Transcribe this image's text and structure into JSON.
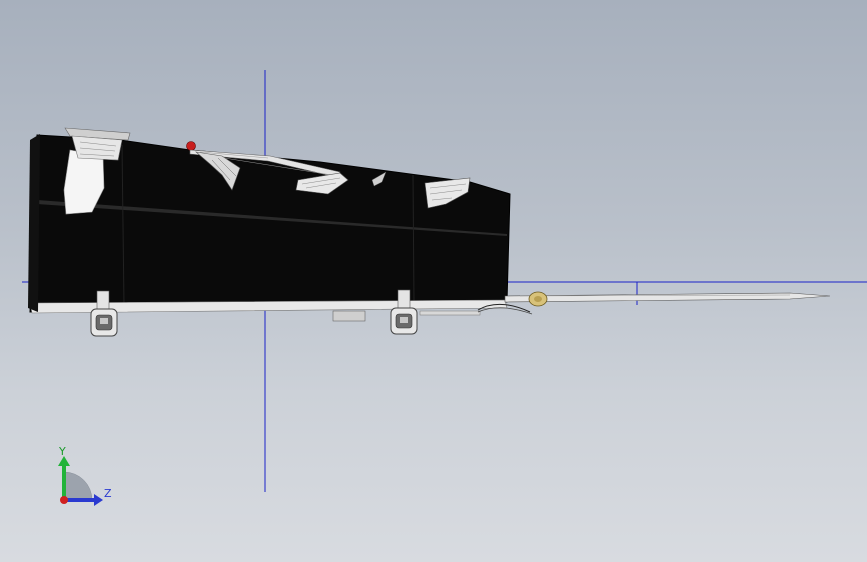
{
  "viewport": {
    "background_top": "#a7b0bd",
    "background_bottom": "#d8dbe0"
  },
  "model": {
    "body_color": "#0a0a0a",
    "accent_color": "#c81e1e",
    "brass_color": "#d8c27a"
  },
  "reference_lines": {
    "color": "#1a22c8"
  },
  "triad": {
    "y_label": "Y",
    "z_label": "Z",
    "y_color": "#22b33a",
    "z_color": "#2a3ad0",
    "origin_color": "#d02020",
    "icons": [
      "y-axis-arrow-icon",
      "z-axis-arrow-icon",
      "x-axis-origin-icon"
    ]
  }
}
